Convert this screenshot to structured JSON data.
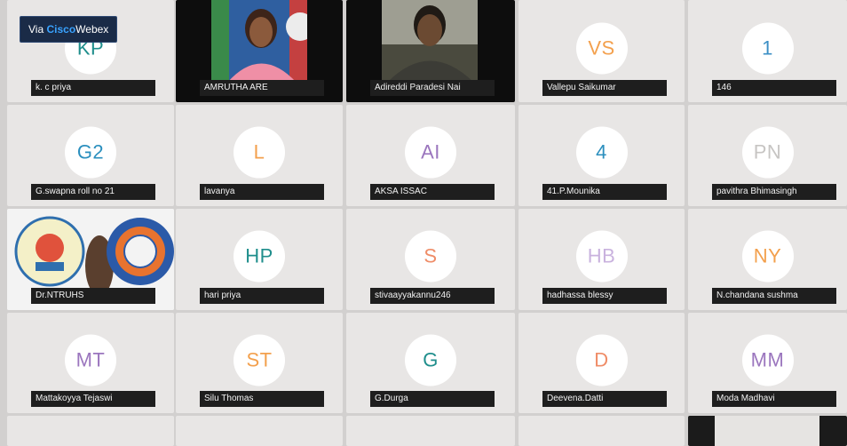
{
  "badge": {
    "via": "Via",
    "cisco": "Cisco",
    "webex": "Webex"
  },
  "participants": [
    {
      "name": "k. c priya",
      "initials": "KP",
      "color": "#1f8e8c"
    },
    {
      "name": "AMRUTHA ARE",
      "initials": "",
      "color": "#000",
      "video": true
    },
    {
      "name": "Adireddi Paradesi Nai",
      "initials": "",
      "color": "#000",
      "video": true
    },
    {
      "name": "Vallepu Saikumar",
      "initials": "VS",
      "color": "#f3a04d"
    },
    {
      "name": "146",
      "initials": "1",
      "color": "#3b8fc5"
    },
    {
      "name": "G.swapna roll no 21",
      "initials": "G2",
      "color": "#2b8fbe"
    },
    {
      "name": "lavanya",
      "initials": "L",
      "color": "#f3a04d"
    },
    {
      "name": "AKSA ISSAC",
      "initials": "AI",
      "color": "#9b76be"
    },
    {
      "name": "41.P.Mounika",
      "initials": "4",
      "color": "#2b8fbe"
    },
    {
      "name": "pavithra Bhimasingh",
      "initials": "PN",
      "color": "#c7c5c3"
    },
    {
      "name": "Dr.NTRUHS",
      "initials": "",
      "color": "#000",
      "video": true
    },
    {
      "name": "hari priya",
      "initials": "HP",
      "color": "#1f8e8c"
    },
    {
      "name": "stivaayyakannu246",
      "initials": "S",
      "color": "#ef8c67"
    },
    {
      "name": "hadhassa blessy",
      "initials": "HB",
      "color": "#c9b2de"
    },
    {
      "name": "N.chandana sushma",
      "initials": "NY",
      "color": "#f3a04d"
    },
    {
      "name": "Mattakoyya Tejaswi",
      "initials": "MT",
      "color": "#9b76be"
    },
    {
      "name": "Silu Thomas",
      "initials": "ST",
      "color": "#f3a04d"
    },
    {
      "name": "G.Durga",
      "initials": "G",
      "color": "#1f8e8c"
    },
    {
      "name": "Deevena.Datti",
      "initials": "D",
      "color": "#ef8c67"
    },
    {
      "name": "Moda Madhavi",
      "initials": "MM",
      "color": "#9b76be"
    }
  ]
}
